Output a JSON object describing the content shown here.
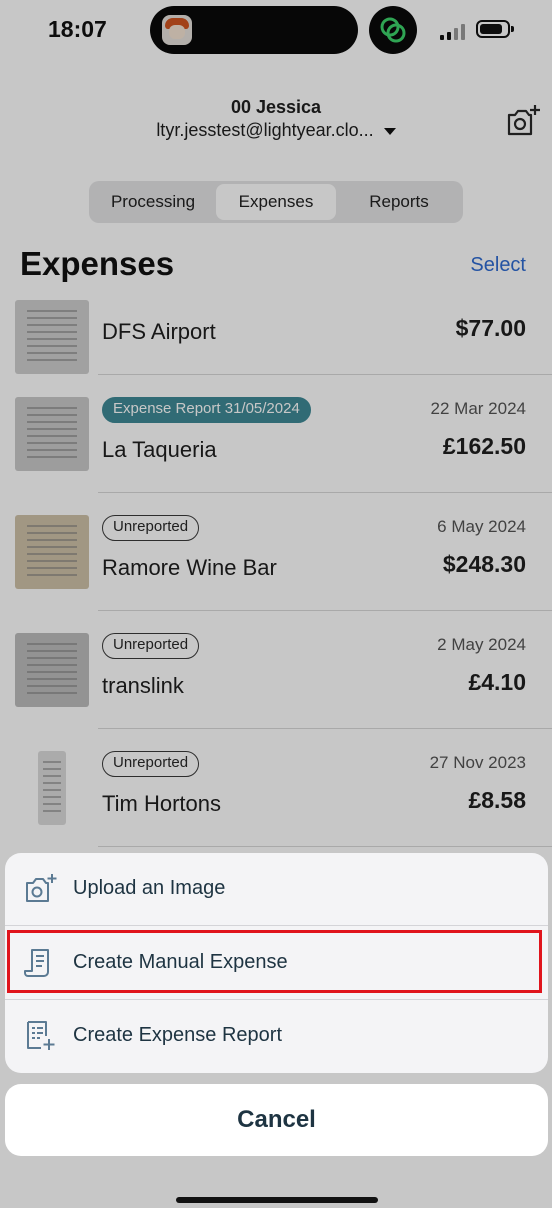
{
  "status_bar": {
    "time": "18:07"
  },
  "header": {
    "account_name": "00 Jessica",
    "account_email": "ltyr.jesstest@lightyear.clo...",
    "tabs": [
      {
        "label": "Processing",
        "active": false
      },
      {
        "label": "Expenses",
        "active": true
      },
      {
        "label": "Reports",
        "active": false
      }
    ]
  },
  "main": {
    "title": "Expenses",
    "select_label": "Select",
    "expenses": [
      {
        "tag": "",
        "tag_style": "outline",
        "merchant": "DFS Airport",
        "date": "",
        "amount": "$77.00"
      },
      {
        "tag": "Expense Report 31/05/2024",
        "tag_style": "filled",
        "merchant": "La Taqueria",
        "date": "22 Mar 2024",
        "amount": "£162.50"
      },
      {
        "tag": "Unreported",
        "tag_style": "outline",
        "merchant": "Ramore Wine Bar",
        "date": "6 May 2024",
        "amount": "$248.30"
      },
      {
        "tag": "Unreported",
        "tag_style": "outline",
        "merchant": "translink",
        "date": "2 May 2024",
        "amount": "£4.10"
      },
      {
        "tag": "Unreported",
        "tag_style": "outline",
        "merchant": "Tim Hortons",
        "date": "27 Nov 2023",
        "amount": "£8.58"
      }
    ]
  },
  "action_sheet": {
    "actions": [
      {
        "label": "Upload an Image",
        "icon": "camera-plus-icon"
      },
      {
        "label": "Create Manual Expense",
        "icon": "receipt-icon"
      },
      {
        "label": "Create Expense Report",
        "icon": "report-add-icon"
      }
    ],
    "cancel_label": "Cancel"
  },
  "colors": {
    "accent": "#2f6bd1",
    "report_tag": "#3f8a96",
    "highlight": "#e0141c",
    "sheet_text": "#1e3442"
  }
}
